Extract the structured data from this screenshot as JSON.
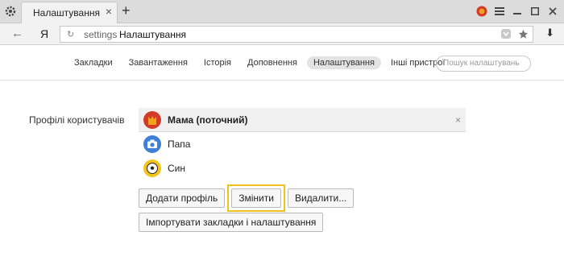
{
  "tab": {
    "title": "Налаштування",
    "close": "×",
    "new_tab": "+"
  },
  "nav": {
    "back": "←",
    "brand": "Я",
    "reload": "↻",
    "url_prefix": "settings",
    "url_page": "Налаштування",
    "download": "⬇"
  },
  "settings_nav": {
    "links": [
      {
        "label": "Закладки",
        "active": false
      },
      {
        "label": "Завантаження",
        "active": false
      },
      {
        "label": "Історія",
        "active": false
      },
      {
        "label": "Доповнення",
        "active": false
      },
      {
        "label": "Налаштування",
        "active": true
      },
      {
        "label": "Інші пристрої",
        "active": false
      }
    ],
    "search_placeholder": "Пошук налаштувань"
  },
  "profiles_section": {
    "label": "Профілі користувачів",
    "profiles": [
      {
        "name": "Мама (поточний)",
        "current": true,
        "avatar": "crown-icon",
        "remove": "×"
      },
      {
        "name": "Папа",
        "current": false,
        "avatar": "camera-icon"
      },
      {
        "name": "Син",
        "current": false,
        "avatar": "soccer-ball-icon"
      }
    ],
    "buttons": {
      "add": "Додати профіль",
      "change": "Змінити",
      "delete": "Видалити...",
      "import": "Імпортувати закладки і налаштування"
    }
  },
  "colors": {
    "highlight": "#f2c21b",
    "brand": "#d23a2a",
    "avatar_blue": "#3f7fd6"
  }
}
